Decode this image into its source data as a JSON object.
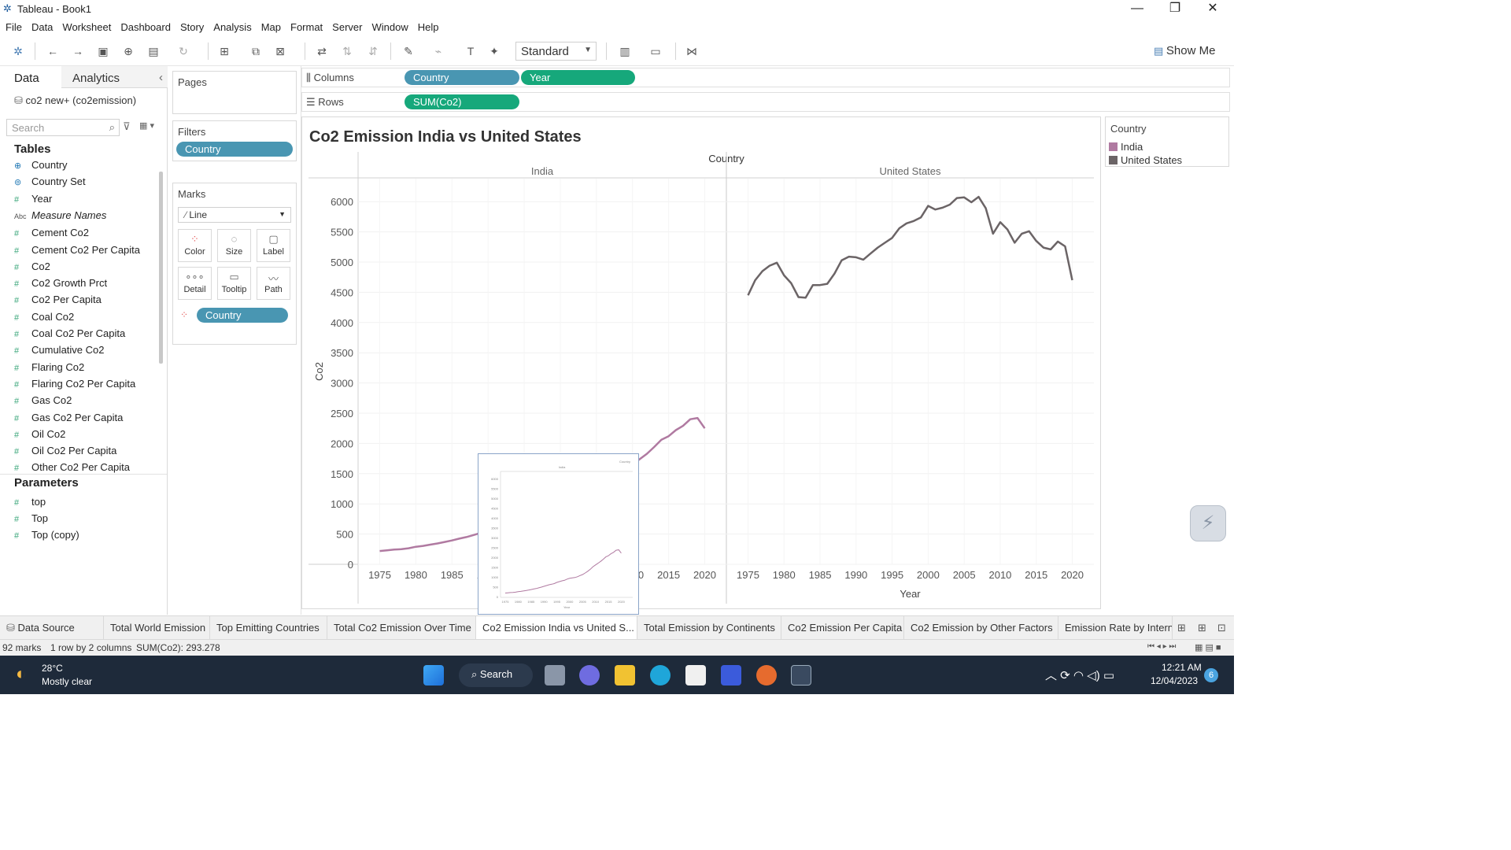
{
  "window": {
    "title": "Tableau - Book1"
  },
  "menu": [
    "File",
    "Data",
    "Worksheet",
    "Dashboard",
    "Story",
    "Analysis",
    "Map",
    "Format",
    "Server",
    "Window",
    "Help"
  ],
  "toolbar": {
    "fit_mode": "Standard",
    "show_me": "Show Me"
  },
  "left_pane": {
    "tab_data": "Data",
    "tab_analytics": "Analytics",
    "datasource": "co2 new+ (co2emission)",
    "search_placeholder": "Search",
    "tables_header": "Tables",
    "fields": [
      {
        "name": "Country",
        "kind": "geo"
      },
      {
        "name": "Country Set",
        "kind": "set"
      },
      {
        "name": "Year",
        "kind": "measure"
      },
      {
        "name": "Measure Names",
        "kind": "abc"
      },
      {
        "name": "Cement Co2",
        "kind": "measure"
      },
      {
        "name": "Cement Co2 Per Capita",
        "kind": "measure"
      },
      {
        "name": "Co2",
        "kind": "measure"
      },
      {
        "name": "Co2 Growth Prct",
        "kind": "measure"
      },
      {
        "name": "Co2 Per Capita",
        "kind": "measure"
      },
      {
        "name": "Coal Co2",
        "kind": "measure"
      },
      {
        "name": "Coal Co2 Per Capita",
        "kind": "measure"
      },
      {
        "name": "Cumulative Co2",
        "kind": "measure"
      },
      {
        "name": "Flaring Co2",
        "kind": "measure"
      },
      {
        "name": "Flaring Co2 Per Capita",
        "kind": "measure"
      },
      {
        "name": "Gas Co2",
        "kind": "measure"
      },
      {
        "name": "Gas Co2 Per Capita",
        "kind": "measure"
      },
      {
        "name": "Oil Co2",
        "kind": "measure"
      },
      {
        "name": "Oil Co2 Per Capita",
        "kind": "measure"
      },
      {
        "name": "Other Co2 Per Capita",
        "kind": "measure"
      }
    ],
    "parameters_header": "Parameters",
    "parameters": [
      "top",
      "Top",
      "Top (copy)"
    ]
  },
  "shelves": {
    "pages": "Pages",
    "filters": "Filters",
    "filter_pill": "Country",
    "marks": "Marks",
    "mark_type": "Line",
    "mark_buttons": [
      "Color",
      "Size",
      "Label",
      "Detail",
      "Tooltip",
      "Path"
    ],
    "color_pill": "Country",
    "columns_label": "Columns",
    "columns_pills": [
      "Country",
      "Year"
    ],
    "rows_label": "Rows",
    "rows_pills": [
      "SUM(Co2)"
    ]
  },
  "legend": {
    "title": "Country",
    "items": [
      {
        "name": "India",
        "color": "#b07aa1"
      },
      {
        "name": "United States",
        "color": "#6b6466"
      }
    ]
  },
  "chart_data": {
    "type": "line",
    "title": "Co2 Emission India vs United States",
    "header": "Country",
    "panes": [
      "India",
      "United States"
    ],
    "xlabel": "Year",
    "ylabel": "Co2",
    "ylim": [
      0,
      6250
    ],
    "xlim": [
      1972,
      2023
    ],
    "x_ticks": [
      1975,
      1980,
      1985,
      1990,
      1995,
      2000,
      2005,
      2010,
      2015,
      2020
    ],
    "y_ticks": [
      0,
      500,
      1000,
      1500,
      2000,
      2500,
      3000,
      3500,
      4000,
      4500,
      5000,
      5500,
      6000
    ],
    "series": [
      {
        "name": "India",
        "color": "#b07aa1",
        "x": [
          1975,
          1976,
          1977,
          1978,
          1979,
          1980,
          1981,
          1982,
          1983,
          1984,
          1985,
          1986,
          1987,
          1988,
          1989,
          1990,
          1991,
          1992,
          1993,
          1994,
          1995,
          1996,
          1997,
          1998,
          1999,
          2000,
          2001,
          2002,
          2003,
          2004,
          2005,
          2006,
          2007,
          2008,
          2009,
          2010,
          2011,
          2012,
          2013,
          2014,
          2015,
          2016,
          2017,
          2018,
          2019,
          2020
        ],
        "values": [
          220,
          232,
          245,
          250,
          265,
          290,
          305,
          325,
          345,
          370,
          395,
          425,
          450,
          485,
          520,
          560,
          600,
          640,
          670,
          700,
          760,
          800,
          840,
          870,
          930,
          970,
          990,
          1010,
          1050,
          1110,
          1160,
          1240,
          1330,
          1430,
          1560,
          1650,
          1740,
          1830,
          1940,
          2060,
          2120,
          2220,
          2290,
          2400,
          2420,
          2250
        ]
      },
      {
        "name": "United States",
        "color": "#6b6466",
        "x": [
          1975,
          1976,
          1977,
          1978,
          1979,
          1980,
          1981,
          1982,
          1983,
          1984,
          1985,
          1986,
          1987,
          1988,
          1989,
          1990,
          1991,
          1992,
          1993,
          1994,
          1995,
          1996,
          1997,
          1998,
          1999,
          2000,
          2001,
          2002,
          2003,
          2004,
          2005,
          2006,
          2007,
          2008,
          2009,
          2010,
          2011,
          2012,
          2013,
          2014,
          2015,
          2016,
          2017,
          2018,
          2019,
          2020
        ],
        "values": [
          4450,
          4700,
          4850,
          4940,
          4990,
          4780,
          4650,
          4420,
          4410,
          4620,
          4620,
          4640,
          4810,
          5030,
          5090,
          5080,
          5040,
          5140,
          5240,
          5320,
          5400,
          5560,
          5640,
          5680,
          5740,
          5930,
          5870,
          5900,
          5950,
          6060,
          6070,
          5990,
          6080,
          5890,
          5470,
          5660,
          5540,
          5320,
          5470,
          5510,
          5350,
          5240,
          5210,
          5340,
          5260,
          4700
        ]
      }
    ]
  },
  "tooltip_thumb": {
    "header": "Country",
    "pane": "India",
    "xlabel": "Year"
  },
  "sheet_tabs": [
    {
      "label": "Data Source",
      "active": false
    },
    {
      "label": "Total World Emission",
      "active": false
    },
    {
      "label": "Top Emitting Countries",
      "active": false
    },
    {
      "label": "Total Co2 Emission Over Time",
      "active": false
    },
    {
      "label": "Co2 Emission India vs United S...",
      "active": true
    },
    {
      "label": "Total Emission by Continents",
      "active": false
    },
    {
      "label": "Co2 Emission Per Capita",
      "active": false
    },
    {
      "label": "Co2 Emission  by Other Factors",
      "active": false
    },
    {
      "label": "Emission Rate by Interna",
      "active": false
    }
  ],
  "status": {
    "marks": "92 marks",
    "rows_cols": "1 row by 2 columns",
    "sum": "SUM(Co2): 293.278"
  },
  "taskbar": {
    "weather_temp": "28°C",
    "weather_desc": "Mostly clear",
    "search_label": "Search",
    "time": "12:21 AM",
    "date": "12/04/2023",
    "notification_count": "6"
  }
}
